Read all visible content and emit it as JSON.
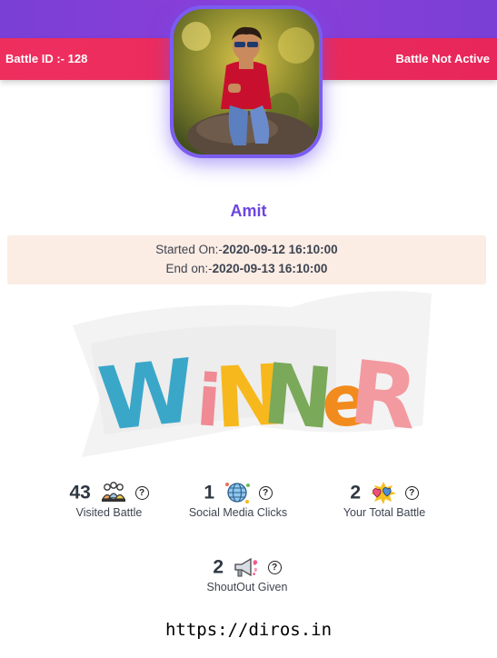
{
  "banner": {
    "battle_id": "Battle ID :- 128",
    "status": "Battle Not Active"
  },
  "profile": {
    "name": "Amit",
    "started_label": "Started On:-",
    "started_value": "2020-09-12 16:10:00",
    "ended_label": "End on:-",
    "ended_value": "2020-09-13 16:10:00"
  },
  "winner_art": {
    "letters": [
      "W",
      "i",
      "N",
      "N",
      "e",
      "R"
    ],
    "colors": [
      "#3aa7c9",
      "#f08a94",
      "#f6b81c",
      "#7aa95a",
      "#f28b1d",
      "#f39aa0"
    ]
  },
  "stats": [
    {
      "value": "43",
      "label": "Visited Battle",
      "icon": "people-group-icon"
    },
    {
      "value": "1",
      "label": "Social Media Clicks",
      "icon": "globe-network-icon"
    },
    {
      "value": "2",
      "label": "Your Total Battle",
      "icon": "battle-hearts-icon"
    },
    {
      "value": "2",
      "label": "ShoutOut Given",
      "icon": "megaphone-icon"
    }
  ],
  "help_glyph": "?",
  "footer": {
    "url": "https://diros.in"
  }
}
